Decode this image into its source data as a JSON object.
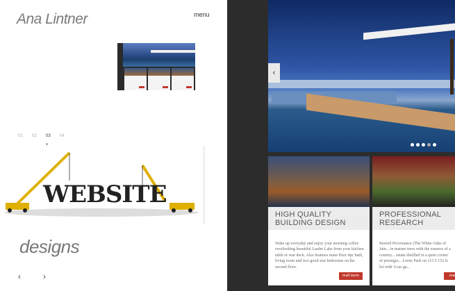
{
  "brand": {
    "name": "Ana Lintner"
  },
  "header": {
    "menu_label": "menu"
  },
  "pager": {
    "items": [
      "01",
      "02",
      "03",
      "04"
    ],
    "active_index": 2
  },
  "feature": {
    "image_text": "WEBSITE",
    "caption": "designs"
  },
  "nav": {
    "prev_glyph": "‹",
    "next_glyph": "›"
  },
  "showcase": {
    "hero_prev_glyph": "‹",
    "dots_count": 5,
    "active_dot": 3,
    "cards": [
      {
        "title_line1": "HIGH QUALITY",
        "title_line2": "BUILDING DESIGN",
        "text": "Wake up everyday and enjoy your morning coffee overlooking beautiful Larder Lake from your kitchen table or rear deck. Also features main floor 4pc bath, living room and two good size bedrooms on the second floor.",
        "button": "read more"
      },
      {
        "title_line1": "PROFESSIONAL",
        "title_line2": "RESEARCH",
        "text": "Storied Provenance (The White Oaks of Jain... in mature trees with the essence of a country... estate distilled in a quiet corner of prestigio... Lorne Park on 115.5 152 ft. lot with 3-car ga...",
        "button": "read"
      }
    ]
  },
  "colors": {
    "accent_red": "#c0392b",
    "dark_panel": "#2c2c2c",
    "muted_text": "#7a7a7a"
  }
}
